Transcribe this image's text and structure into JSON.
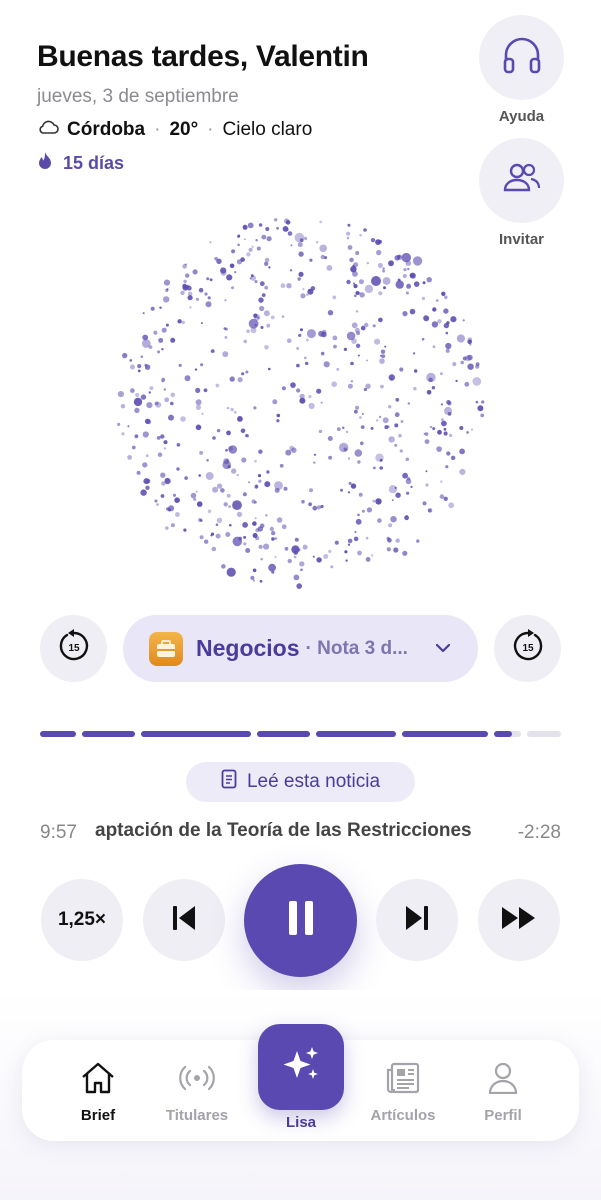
{
  "header": {
    "greeting": "Buenas tardes, Valentin",
    "date": "jueves, 3 de septiembre",
    "weather": {
      "icon": "cloud-icon",
      "city": "Córdoba",
      "temp": "20°",
      "condition": "Cielo claro"
    },
    "streak": {
      "icon": "flame-icon",
      "label": "15 días"
    }
  },
  "side_actions": {
    "help_label": "Ayuda",
    "invite_label": "Invitar"
  },
  "player": {
    "skip_back_label": "15",
    "skip_forward_label": "15",
    "section": {
      "icon": "briefcase-icon",
      "name": "Negocios",
      "detail": "· Nota 3 d..."
    },
    "progress": {
      "segments_total": 8,
      "segments_played": 6,
      "current_segment_fraction": 0.65
    },
    "read_button_label": "Leé esta noticia",
    "elapsed": "9:57",
    "remaining": "-2:28",
    "title": "aptación de la Teoría de las Restricciones",
    "speed_label": "1,25×"
  },
  "nav": {
    "items": [
      {
        "label": "Brief",
        "icon": "home-icon",
        "active": true
      },
      {
        "label": "Titulares",
        "icon": "broadcast-icon",
        "active": false
      },
      {
        "label": "Lisa",
        "icon": "sparkles-icon",
        "active": false
      },
      {
        "label": "Artículos",
        "icon": "newspaper-icon",
        "active": false
      },
      {
        "label": "Perfil",
        "icon": "user-icon",
        "active": false
      }
    ]
  },
  "colors": {
    "accent": "#5a49b0",
    "accent_light": "#e9e6f8",
    "dot": "#5b4cb0",
    "muted": "#8a8a90"
  }
}
